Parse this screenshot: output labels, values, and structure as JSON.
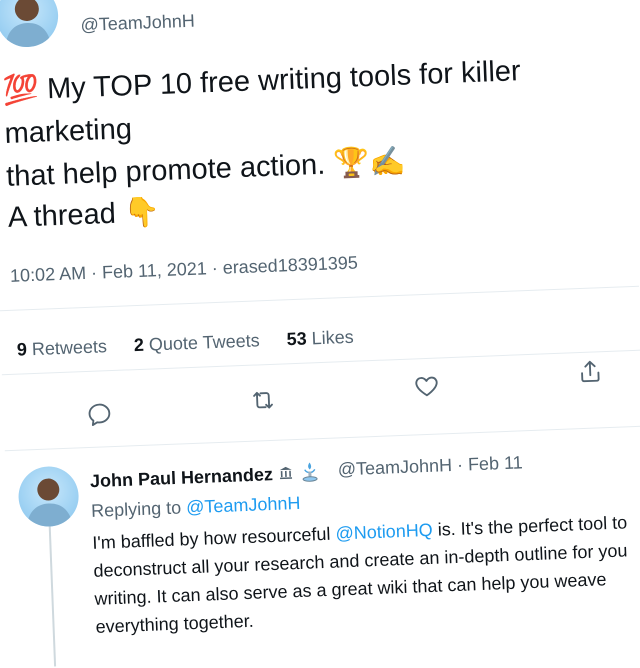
{
  "tweet": {
    "handle": "@TeamJohnH",
    "emoji_hundred": "💯",
    "text_line1": "My TOP 10 free writing tools for killer marketing",
    "text_line2": "that help promote action.",
    "emoji_trophy": "🏆",
    "emoji_writing": "✍️",
    "thread_text": "A thread",
    "emoji_point_down": "👇",
    "meta": "10:02 AM · Feb 11, 2021 · erased18391395"
  },
  "stats": {
    "retweets_count": "9",
    "retweets_label": "Retweets",
    "quotes_count": "2",
    "quotes_label": "Quote Tweets",
    "likes_count": "53",
    "likes_label": "Likes"
  },
  "actions": [
    "reply-icon",
    "retweet-icon",
    "like-icon",
    "share-icon"
  ],
  "reply": {
    "name": "John Paul Hernandez",
    "badges": [
      "bank-icon",
      "fountain-icon"
    ],
    "handle_date": "@TeamJohnH · Feb 11",
    "replying_prefix": "Replying to",
    "replying_handle": "@TeamJohnH",
    "line1_a": "I'm baffled by how resourceful",
    "line1_mention": "@NotionHQ",
    "line1_b": "is. It's the perfect tool to",
    "line2": "deconstruct all your research and create an in-depth outline for you",
    "line3": "writing. It can also serve as a great wiki that can help you weave",
    "line4": "everything together."
  },
  "colors": {
    "link": "#1d9bf0",
    "muted": "#536471",
    "text": "#0f1419"
  }
}
